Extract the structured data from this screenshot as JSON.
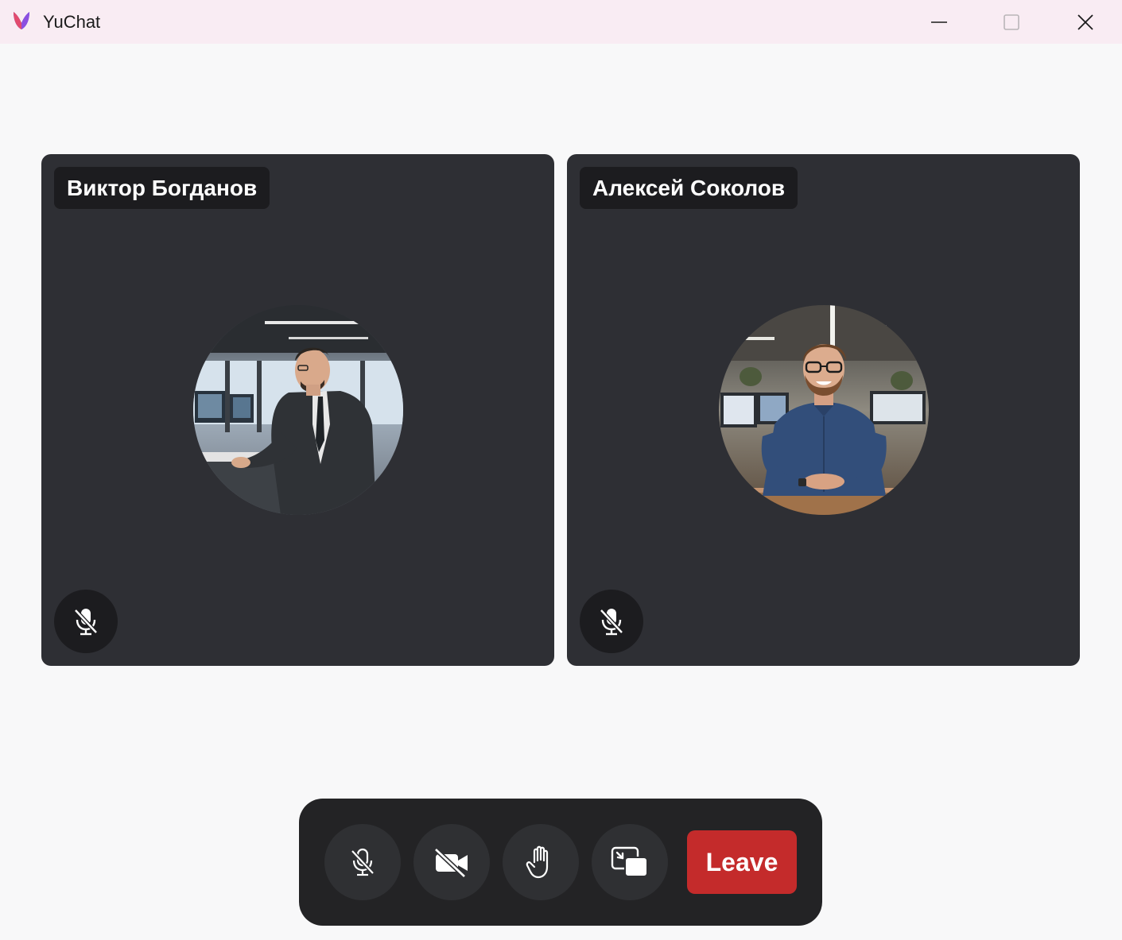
{
  "window": {
    "title": "YuChat"
  },
  "participants": [
    {
      "name": "Виктор Богданов",
      "muted": true
    },
    {
      "name": "Алексей Соколов",
      "muted": true
    }
  ],
  "controls": {
    "microphone": "muted",
    "camera": "off",
    "leave_label": "Leave"
  },
  "colors": {
    "titlebar": "#f9ecf3",
    "background": "#f8f8f9",
    "tile": "#2e2f34",
    "tag": "#1c1c1f",
    "control_bar": "#232325",
    "control_button": "#2f3033",
    "leave": "#c42b2b"
  },
  "icons": {
    "app": "yuchat-logo-icon",
    "minimize": "minimize-icon",
    "maximize": "maximize-icon",
    "close": "close-icon",
    "mic_off": "mic-off-icon",
    "camera_off": "camera-off-icon",
    "raise_hand": "hand-icon",
    "screen_share": "screen-share-icon"
  }
}
